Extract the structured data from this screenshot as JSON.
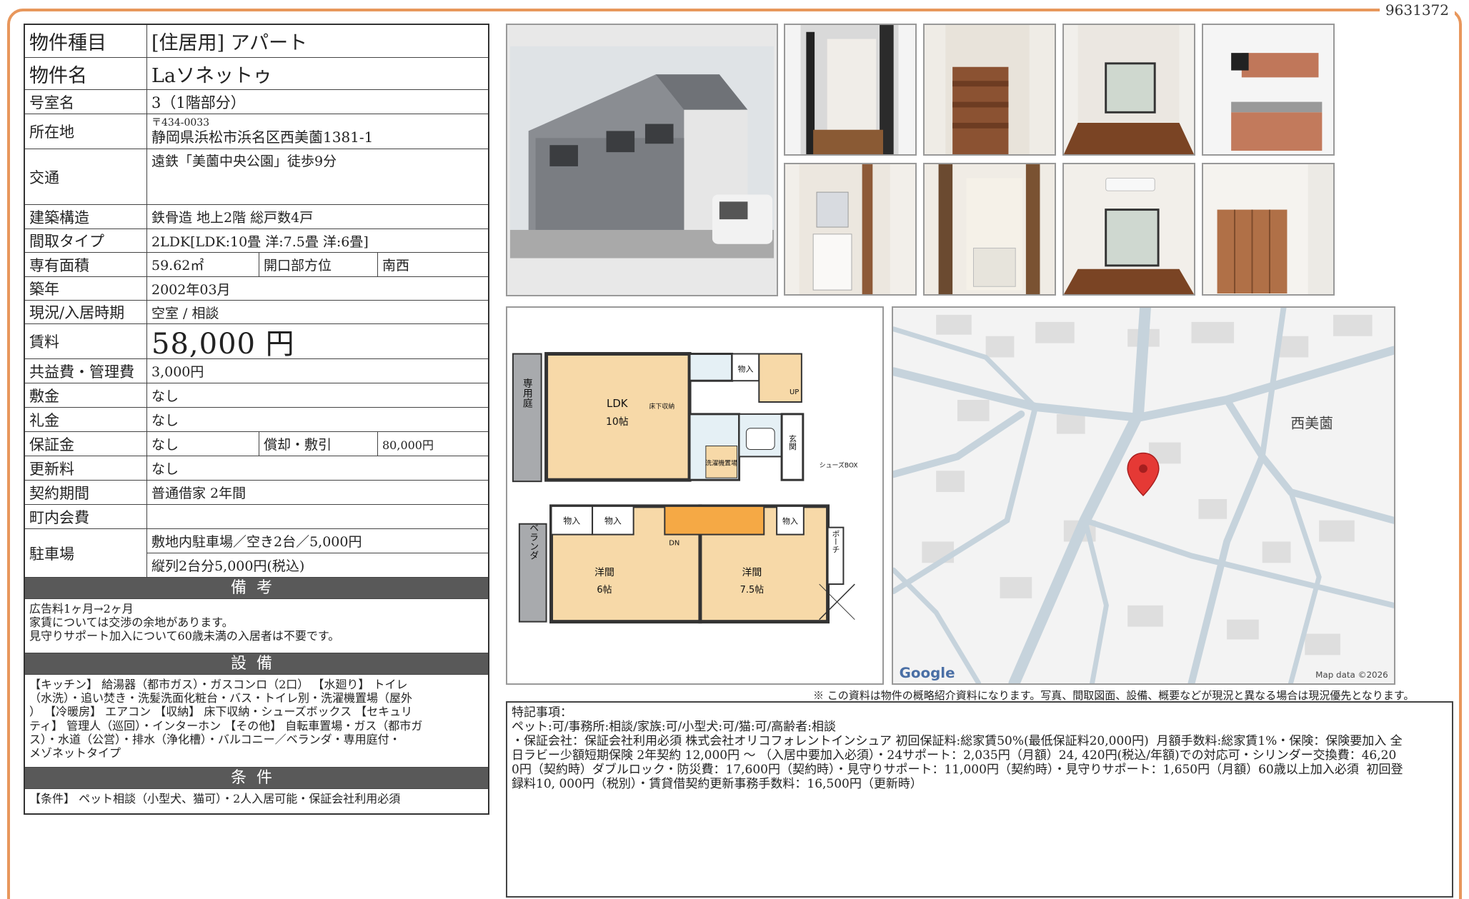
{
  "doc_id": "9631372",
  "info": {
    "type_label": "物件種目",
    "type_value": "[住居用]  アパート",
    "name_label": "物件名",
    "name_value": "Laソネットゥ",
    "room_label": "号室名",
    "room_value": "3（1階部分）",
    "address_label": "所在地",
    "zip": "〒434-0033",
    "address": "静岡県浜松市浜名区西美薗1381-1",
    "traffic_label": "交通",
    "traffic_value": "遠鉄「美薗中央公園」徒歩9分",
    "structure_label": "建築構造",
    "structure_value": "鉄骨造  地上2階  総戸数4戸",
    "layout_label": "間取タイプ",
    "layout_value": "2LDK[LDK:10畳  洋:7.5畳  洋:6畳]",
    "area_label": "専有面積",
    "area_value": "59.62㎡",
    "direction_label": "開口部方位",
    "direction_value": "南西",
    "built_label": "築年",
    "built_value": "2002年03月",
    "status_label": "現況/入居時期",
    "status_value": "空室  /  相談",
    "rent_label": "賃料",
    "rent_value": "58,000 円",
    "fee_label": "共益費・管理費",
    "fee_value": "3,000円",
    "deposit_label": "敷金",
    "deposit_value": "なし",
    "key_label": "礼金",
    "key_value": "なし",
    "guarantee_label": "保証金",
    "guarantee_value": "なし",
    "amort_label": "償却・敷引",
    "amort_value": "80,000円",
    "renewal_label": "更新料",
    "renewal_value": "なし",
    "contract_label": "契約期間",
    "contract_value": "普通借家  2年間",
    "community_label": "町内会費",
    "community_value": "",
    "parking_label": "駐車場",
    "parking_value_1": "敷地内駐車場／空き2台／5,000円",
    "parking_value_2": "縦列2台分5,000円(税込)"
  },
  "remarks": {
    "heading": "備考",
    "lines": [
      "広告料1ヶ月→2ヶ月",
      "家賃については交渉の余地があります。",
      "見守りサポート加入について60歳未満の入居者は不要です。"
    ]
  },
  "equipment": {
    "heading": "設備",
    "lines": [
      "【キッチン】 給湯器（都市ガス）・ガスコンロ（2口） 【水廻り】 トイレ",
      "（水洗）・追い焚き・洗髪洗面化粧台・バス・トイレ別・洗濯機置場（屋外",
      "） 【冷暖房】 エアコン 【収納】 床下収納・シューズボックス 【セキュリ",
      "ティ】 管理人（巡回）・インターホン 【その他】 自転車置場・ガス（都市ガ",
      "ス）・水道（公営）・排水（浄化槽）・バルコニー／ベランダ・専用庭付・",
      "メゾネットタイプ"
    ]
  },
  "conditions": {
    "heading": "条件",
    "lines": [
      "【条件】 ペット相談（小型犬、猫可）・2人入居可能・保証会社利用必須"
    ]
  },
  "floorplan": {
    "ldk": "LDK",
    "ldk_size": "10帖",
    "underfloor": "床下収納",
    "storage": "物入",
    "garden": "専用庭",
    "entrance": "玄関",
    "shoes": "シューズBOX",
    "washer": "洗濯機置場",
    "up": "UP",
    "dn": "DN",
    "veranda": "ベランダ",
    "porch": "ポーチ",
    "room_a": "洋間",
    "room_a_size": "6帖",
    "room_b": "洋間",
    "room_b_size": "7.5帖"
  },
  "map": {
    "area_name": "西美薗",
    "brand": "Google",
    "copyright": "Map data ©2026"
  },
  "note": "※ この資料は物件の概略紹介資料になります。写真、間取図面、設備、概要などが現況と異なる場合は現況優先となります。",
  "special": {
    "title": "特記事項：",
    "lines": [
      "ペット:可/事務所:相談/家族:可/小型犬:可/猫:可/高齢者:相談",
      "・保証会社：保証会社利用必須 株式会社オリコフォレントインシュア 初回保証料:総家賃50%(最低保証料20,000円)  月額手数料:総家賃1%・保険：保険要加入 全",
      "日ラビー少額短期保険 2年契約 12,000円 ～ （入居中要加入必須）・24サポート：2,035円（月額）24, 420円(税込/年額)での対応可・シリンダー交換費：46,20",
      "0円（契約時）ダブルロック・防災費：17,600円（契約時）・見守りサポート：11,000円（契約時）・見守りサポート：1,650円（月額）60歳以上加入必須  初回登",
      "録料10, 000円（税別）・賃貸借契約更新事務手数料：16,500円（更新時）"
    ]
  }
}
